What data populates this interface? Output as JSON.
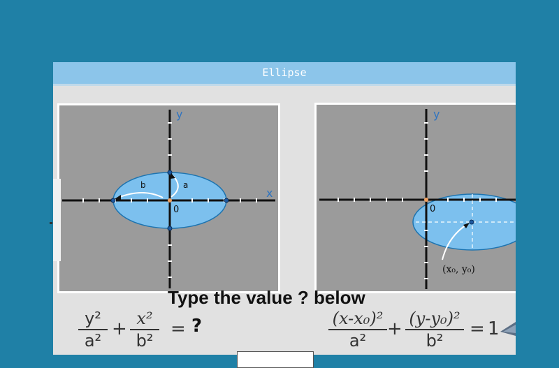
{
  "window": {
    "title": "Ellipse"
  },
  "left_diagram": {
    "axis_y": "y",
    "axis_x": "x",
    "origin": "0",
    "label_b": "b",
    "label_a": "a"
  },
  "right_diagram": {
    "axis_y": "y",
    "origin": "0",
    "center_label": "(x₀, y₀)"
  },
  "prompt": "Type the value ? below",
  "equation_left": {
    "term1_num": "y²",
    "term1_den": "a²",
    "plus": "+",
    "term2_num": "x²",
    "term2_den": "b²",
    "equals": "=",
    "rhs": "?"
  },
  "equation_right": {
    "term1_num": "(x-x₀)²",
    "term1_den": "a²",
    "plus": "+",
    "term2_num": "(y-y₀)²",
    "term2_den": "b²",
    "equals": "=",
    "rhs": "1"
  },
  "answer": {
    "value": ""
  },
  "colors": {
    "ellipse_fill": "#7cc0ee",
    "panel": "#9b9b9b",
    "title": "#8cc5ea",
    "background": "#1f80a6"
  },
  "icons": {
    "pencil": "pencil-icon"
  }
}
